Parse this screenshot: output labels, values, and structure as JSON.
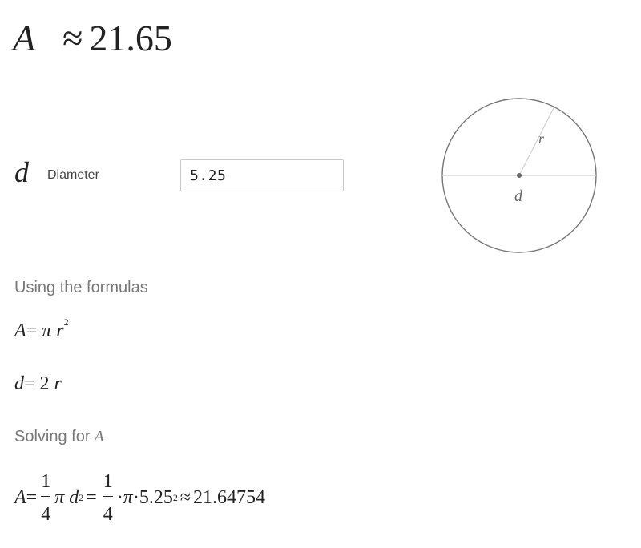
{
  "result": {
    "variable": "A",
    "approx_symbol": "≈",
    "value": "21.65"
  },
  "input": {
    "variable": "d",
    "label": "Diameter",
    "value": "5.25"
  },
  "diagram": {
    "radius_label": "r",
    "diameter_label": "d"
  },
  "explanation": {
    "formulas_heading": "Using the formulas",
    "formula1": {
      "lhs": "A",
      "eq": "=",
      "pi": "π",
      "r": "r",
      "exp": "2"
    },
    "formula2": {
      "lhs": "d",
      "eq": "=",
      "coef": "2",
      "r": "r"
    },
    "solving_heading": "Solving for",
    "solving_var": "A",
    "solution": {
      "lhs": "A",
      "eq1": "=",
      "frac1_num": "1",
      "frac1_den": "4",
      "pi": "π",
      "d": "d",
      "exp1": "2",
      "eq2": "=",
      "frac2_num": "1",
      "frac2_den": "4",
      "dot1": "·",
      "pi2": "π",
      "dot2": "·",
      "val": "5.25",
      "exp2": "2",
      "approx": "≈",
      "result": "21.64754"
    }
  }
}
